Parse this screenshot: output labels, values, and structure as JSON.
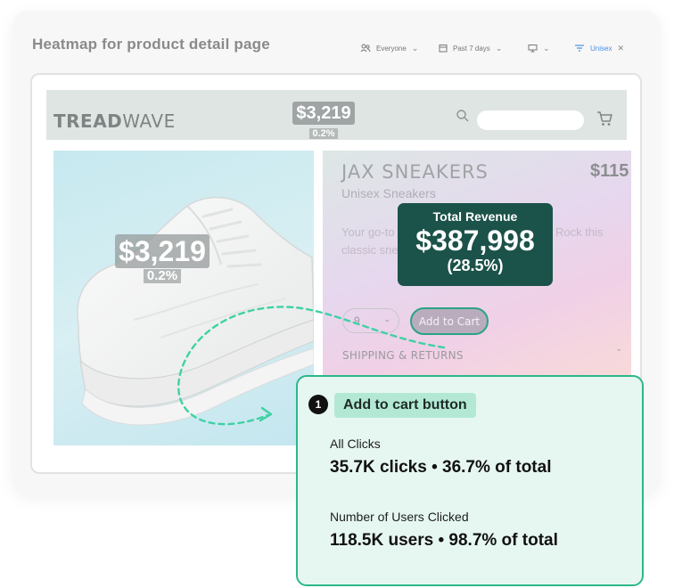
{
  "header": {
    "title": "Heatmap for product detail page",
    "filters": [
      {
        "label": "Everyone",
        "icon": "users-icon"
      },
      {
        "label": "Past 7 days",
        "icon": "calendar-icon"
      },
      {
        "label": "",
        "icon": "monitor-icon"
      },
      {
        "label": "Unisex",
        "icon": "filter-icon"
      }
    ]
  },
  "store": {
    "logo_bold": "TREAD",
    "logo_light": "WAVE",
    "nav_stat": {
      "value": "$3,219",
      "pct": "0.2%"
    }
  },
  "image_stat": {
    "value": "$3,219",
    "pct": "0.2%"
  },
  "product": {
    "name": "JAX SNEAKERS",
    "price": "$115",
    "subtitle": "Unisex Sneakers",
    "desc_start": "Your go-to",
    "desc_tail": "Rock this",
    "desc_line2": "classic sne",
    "size": "9",
    "add_to_cart": "Add to Cart",
    "shipping": "SHIPPING & RETURNS"
  },
  "revenue": {
    "label": "Total Revenue",
    "value": "$387,998",
    "pct": "(28.5%)"
  },
  "tooltip": {
    "number": "1",
    "title": "Add to cart button",
    "metric1_label": "All Clicks",
    "metric1_value": "35.7K clicks • 36.7% of total",
    "metric2_label": "Number of Users Clicked",
    "metric2_value": "118.5K users • 98.7% of total"
  },
  "colors": {
    "accent": "#2bb88a",
    "revenue_bg": "#1b5249",
    "tooltip_bg": "#e6f7f1"
  }
}
